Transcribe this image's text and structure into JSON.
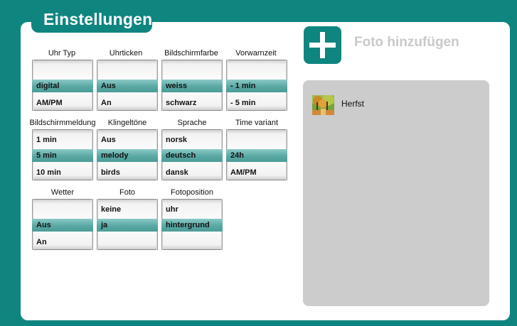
{
  "title": "Einstellungen",
  "add_photo": {
    "label": "Foto hinzufügen",
    "icon": "plus-icon"
  },
  "colors": {
    "accent": "#0f8580",
    "selection": "#5aa8a4",
    "list_bg": "#cccccc"
  },
  "pickers": [
    {
      "id": "uhr-typ",
      "label": "Uhr Typ",
      "options": [
        "",
        "digital",
        "AM/PM"
      ],
      "selected": "digital"
    },
    {
      "id": "uhrticken",
      "label": "Uhrticken",
      "options": [
        "",
        "Aus",
        "An"
      ],
      "selected": "Aus"
    },
    {
      "id": "bildschirmfarbe",
      "label": "Bildschirmfarbe",
      "options": [
        "",
        "weiss",
        "schwarz"
      ],
      "selected": "weiss"
    },
    {
      "id": "vorwarnzeit",
      "label": "Vorwarnzeit",
      "options": [
        "",
        "- 1 min",
        "- 5 min"
      ],
      "selected": "- 1 min"
    },
    {
      "id": "bildschirmmeldung",
      "label": "Bildschirmmeldung",
      "options": [
        "1 min",
        "5 min",
        "10 min"
      ],
      "selected": "5 min"
    },
    {
      "id": "klingeltoene",
      "label": "Klingeltöne",
      "options": [
        "Aus",
        "melody",
        "birds"
      ],
      "selected": "melody"
    },
    {
      "id": "sprache",
      "label": "Sprache",
      "options": [
        "norsk",
        "deutsch",
        "dansk"
      ],
      "selected": "deutsch"
    },
    {
      "id": "time-variant",
      "label": "Time variant",
      "options": [
        "",
        "24h",
        "AM/PM"
      ],
      "selected": "24h"
    },
    {
      "id": "wetter",
      "label": "Wetter",
      "options": [
        "",
        "Aus",
        "An"
      ],
      "selected": "Aus"
    },
    {
      "id": "foto",
      "label": "Foto",
      "options": [
        "keine",
        "ja",
        ""
      ],
      "selected": "ja"
    },
    {
      "id": "fotoposition",
      "label": "Fotoposition",
      "options": [
        "uhr",
        "hintergrund",
        ""
      ],
      "selected": "hintergrund"
    }
  ],
  "photos": [
    {
      "name": "Herfst",
      "thumbnail": "autumn-forest-thumbnail"
    }
  ]
}
